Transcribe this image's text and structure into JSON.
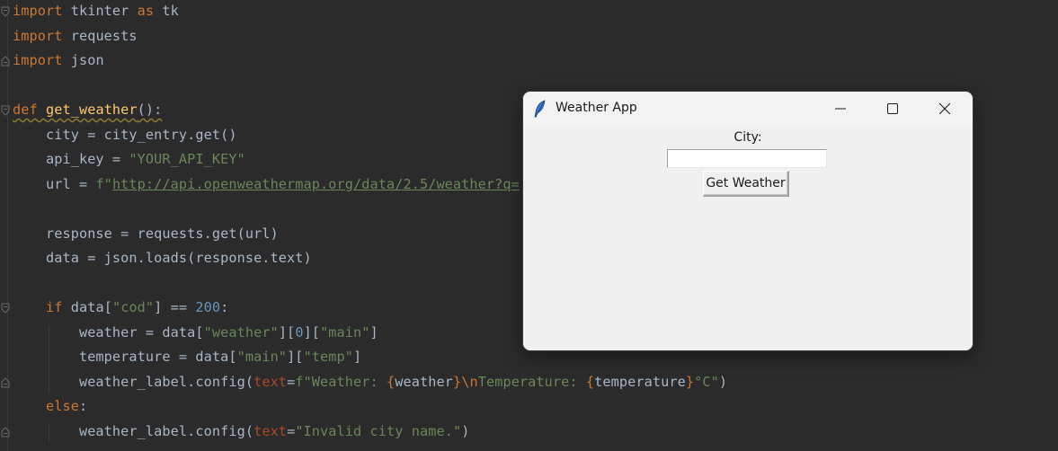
{
  "editor": {
    "lines": [
      {
        "tokens": [
          {
            "t": "import",
            "c": "kw"
          },
          {
            "t": " tkinter ",
            "c": ""
          },
          {
            "t": "as",
            "c": "kw"
          },
          {
            "t": " tk",
            "c": ""
          }
        ],
        "fold": "open"
      },
      {
        "tokens": [
          {
            "t": "import",
            "c": "kw"
          },
          {
            "t": " requests",
            "c": ""
          }
        ]
      },
      {
        "tokens": [
          {
            "t": "import",
            "c": "kw"
          },
          {
            "t": " json",
            "c": ""
          }
        ],
        "fold": "close"
      },
      {
        "tokens": []
      },
      {
        "tokens": [
          {
            "t": "def",
            "c": "kw squiggle"
          },
          {
            "t": " ",
            "c": "squiggle"
          },
          {
            "t": "get_weather",
            "c": "fn squiggle"
          },
          {
            "t": "():",
            "c": "squiggle"
          }
        ],
        "fold": "open"
      },
      {
        "tokens": [
          {
            "t": "    city = city_entry.get()",
            "c": ""
          }
        ]
      },
      {
        "tokens": [
          {
            "t": "    api_key = ",
            "c": ""
          },
          {
            "t": "\"YOUR_API_KEY\"",
            "c": "str"
          }
        ]
      },
      {
        "tokens": [
          {
            "t": "    url = ",
            "c": ""
          },
          {
            "t": "f\"",
            "c": "str"
          },
          {
            "t": "http://api.openweathermap.org/data/2.5/weather?q=",
            "c": "url"
          }
        ]
      },
      {
        "tokens": []
      },
      {
        "tokens": [
          {
            "t": "    response = requests.get(url)",
            "c": ""
          }
        ]
      },
      {
        "tokens": [
          {
            "t": "    data = json.loads(response.text)",
            "c": ""
          }
        ]
      },
      {
        "tokens": []
      },
      {
        "tokens": [
          {
            "t": "    ",
            "c": ""
          },
          {
            "t": "if",
            "c": "kw"
          },
          {
            "t": " data[",
            "c": ""
          },
          {
            "t": "\"cod\"",
            "c": "str"
          },
          {
            "t": "] == ",
            "c": ""
          },
          {
            "t": "200",
            "c": "num"
          },
          {
            "t": ":",
            "c": ""
          }
        ],
        "fold": "open"
      },
      {
        "tokens": [
          {
            "t": "        weather = data[",
            "c": ""
          },
          {
            "t": "\"weather\"",
            "c": "str"
          },
          {
            "t": "][",
            "c": ""
          },
          {
            "t": "0",
            "c": "num"
          },
          {
            "t": "][",
            "c": ""
          },
          {
            "t": "\"main\"",
            "c": "str"
          },
          {
            "t": "]",
            "c": ""
          }
        ]
      },
      {
        "tokens": [
          {
            "t": "        temperature = data[",
            "c": ""
          },
          {
            "t": "\"main\"",
            "c": "str"
          },
          {
            "t": "][",
            "c": ""
          },
          {
            "t": "\"temp\"",
            "c": "str"
          },
          {
            "t": "]",
            "c": ""
          }
        ]
      },
      {
        "tokens": [
          {
            "t": "        weather_label.config(",
            "c": ""
          },
          {
            "t": "text",
            "c": "param"
          },
          {
            "t": "=",
            "c": ""
          },
          {
            "t": "f\"Weather: ",
            "c": "str"
          },
          {
            "t": "{",
            "c": "brace"
          },
          {
            "t": "weather",
            "c": ""
          },
          {
            "t": "}",
            "c": "brace"
          },
          {
            "t": "\\n",
            "c": "kw"
          },
          {
            "t": "Temperature: ",
            "c": "str"
          },
          {
            "t": "{",
            "c": "brace"
          },
          {
            "t": "temperature",
            "c": ""
          },
          {
            "t": "}",
            "c": "brace"
          },
          {
            "t": "°C\"",
            "c": "str"
          },
          {
            "t": ")",
            "c": ""
          }
        ],
        "fold": "close"
      },
      {
        "tokens": [
          {
            "t": "    ",
            "c": ""
          },
          {
            "t": "else",
            "c": "kw"
          },
          {
            "t": ":",
            "c": ""
          }
        ]
      },
      {
        "tokens": [
          {
            "t": "        weather_label.config(",
            "c": ""
          },
          {
            "t": "text",
            "c": "param"
          },
          {
            "t": "=",
            "c": ""
          },
          {
            "t": "\"Invalid city name.\"",
            "c": "str"
          },
          {
            "t": ")",
            "c": ""
          }
        ],
        "fold": "close"
      }
    ]
  },
  "window": {
    "title": "Weather App",
    "app_icon": "feather-icon",
    "controls": {
      "minimize": "minimize-icon",
      "maximize": "maximize-icon",
      "close": "close-icon"
    },
    "city_label": "City:",
    "city_entry_value": "",
    "get_button_label": "Get Weather",
    "weather_label": ""
  }
}
